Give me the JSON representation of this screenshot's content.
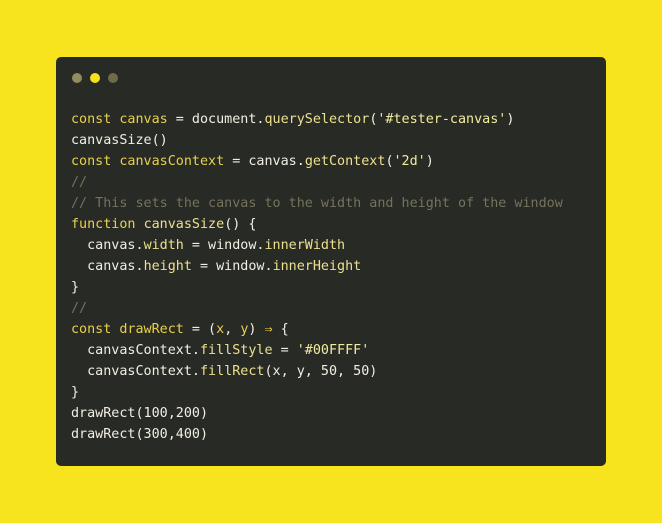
{
  "colors": {
    "background": "#f7e41f",
    "window": "#282a26",
    "keyword": "#e7d14b",
    "function": "#ece08e",
    "string": "#f2ec9f",
    "comment": "#74735d",
    "text": "#f1efe3"
  },
  "window_dots": [
    "dot-gray",
    "dot-yellow",
    "dot-dark"
  ],
  "code_lines": [
    [
      [
        "kw",
        "const"
      ],
      [
        "pl",
        " "
      ],
      [
        "kw",
        "canvas"
      ],
      [
        "pl",
        " = document."
      ],
      [
        "fn",
        "querySelector"
      ],
      [
        "pl",
        "("
      ],
      [
        "str",
        "'#tester-canvas'"
      ],
      [
        "pl",
        ")"
      ]
    ],
    [
      [
        "pl",
        "canvasSize()"
      ]
    ],
    [
      [
        "kw",
        "const"
      ],
      [
        "pl",
        " "
      ],
      [
        "kw",
        "canvasContext"
      ],
      [
        "pl",
        " = canvas."
      ],
      [
        "fn",
        "getContext"
      ],
      [
        "pl",
        "("
      ],
      [
        "str",
        "'2d'"
      ],
      [
        "pl",
        ")"
      ]
    ],
    [
      [
        "com",
        "//"
      ]
    ],
    [
      [
        "com",
        "// This sets the canvas to the width and height of the window"
      ]
    ],
    [
      [
        "kw",
        "function"
      ],
      [
        "pl",
        " "
      ],
      [
        "fn",
        "canvasSize"
      ],
      [
        "pl",
        "() {"
      ]
    ],
    [
      [
        "pl",
        "  canvas."
      ],
      [
        "fn",
        "width"
      ],
      [
        "pl",
        " = window."
      ],
      [
        "fn",
        "innerWidth"
      ]
    ],
    [
      [
        "pl",
        "  canvas."
      ],
      [
        "fn",
        "height"
      ],
      [
        "pl",
        " = window."
      ],
      [
        "fn",
        "innerHeight"
      ]
    ],
    [
      [
        "pl",
        "}"
      ]
    ],
    [
      [
        "com",
        "//"
      ]
    ],
    [
      [
        "kw",
        "const"
      ],
      [
        "pl",
        " "
      ],
      [
        "kw",
        "drawRect"
      ],
      [
        "pl",
        " = ("
      ],
      [
        "kw",
        "x"
      ],
      [
        "pl",
        ", "
      ],
      [
        "kw",
        "y"
      ],
      [
        "pl",
        ") "
      ],
      [
        "kw",
        "⇒"
      ],
      [
        "pl",
        " {"
      ]
    ],
    [
      [
        "pl",
        "  canvasContext."
      ],
      [
        "fn",
        "fillStyle"
      ],
      [
        "pl",
        " = "
      ],
      [
        "str",
        "'#00FFFF'"
      ]
    ],
    [
      [
        "pl",
        "  canvasContext."
      ],
      [
        "fn",
        "fillRect"
      ],
      [
        "pl",
        "(x, y, 50, 50)"
      ]
    ],
    [
      [
        "pl",
        "}"
      ]
    ],
    [
      [
        "pl",
        "drawRect(100,200)"
      ]
    ],
    [
      [
        "pl",
        "drawRect(300,400)"
      ]
    ]
  ]
}
